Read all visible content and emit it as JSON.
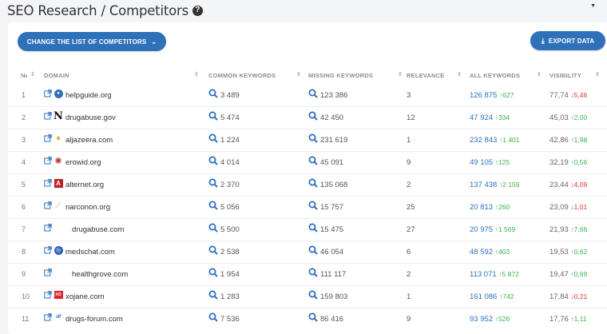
{
  "header": {
    "title": "SEO Research / Competitors",
    "help_icon": "?"
  },
  "toolbar": {
    "change_label": "CHANGE THE LIST OF COMPETITORS",
    "export_label": "EXPORT DATA"
  },
  "table": {
    "columns": [
      "№",
      "DOMAIN",
      "COMMON KEYWORDS",
      "MISSING KEYWORDS",
      "RELEVANCE",
      "ALL KEYWORDS",
      "VISIBILITY"
    ],
    "rows": [
      {
        "n": "1",
        "domain": "helpguide.org",
        "fav": "globe",
        "common": "3 489",
        "missing": "123 386",
        "relevance": "3",
        "all": "126 875",
        "all_change": "627",
        "all_dir": "up",
        "vis": "77,74",
        "vis_change": "5,46",
        "vis_dir": "down"
      },
      {
        "n": "2",
        "domain": "drugabuse.gov",
        "fav": "N",
        "common": "5 474",
        "missing": "42 450",
        "relevance": "12",
        "all": "47 924",
        "all_change": "334",
        "all_dir": "up",
        "vis": "45,03",
        "vis_change": "2,00",
        "vis_dir": "up"
      },
      {
        "n": "3",
        "domain": "aljazeera.com",
        "fav": "flame",
        "common": "1 224",
        "missing": "231 619",
        "relevance": "1",
        "all": "232 843",
        "all_change": "1 401",
        "all_dir": "up",
        "vis": "42,86",
        "vis_change": "1,98",
        "vis_dir": "up"
      },
      {
        "n": "4",
        "domain": "erowid.org",
        "fav": "gear",
        "common": "4 014",
        "missing": "45 091",
        "relevance": "9",
        "all": "49 105",
        "all_change": "125",
        "all_dir": "up",
        "vis": "32,19",
        "vis_change": "0,56",
        "vis_dir": "up"
      },
      {
        "n": "5",
        "domain": "alternet.org",
        "fav": "A",
        "common": "2 370",
        "missing": "135 068",
        "relevance": "2",
        "all": "137 438",
        "all_change": "2 159",
        "all_dir": "up",
        "vis": "23,44",
        "vis_change": "4,09",
        "vis_dir": "down"
      },
      {
        "n": "6",
        "domain": "narconon.org",
        "fav": "feather",
        "common": "5 056",
        "missing": "15 757",
        "relevance": "25",
        "all": "20 813",
        "all_change": "260",
        "all_dir": "up",
        "vis": "23,09",
        "vis_change": "1,01",
        "vis_dir": "down"
      },
      {
        "n": "7",
        "domain": "drugabuse.com",
        "fav": "",
        "common": "5 500",
        "missing": "15 475",
        "relevance": "27",
        "all": "20 975",
        "all_change": "1 569",
        "all_dir": "up",
        "vis": "21,93",
        "vis_change": "7,66",
        "vis_dir": "up"
      },
      {
        "n": "8",
        "domain": "medschat.com",
        "fav": "circle",
        "common": "2 538",
        "missing": "46 054",
        "relevance": "6",
        "all": "48 592",
        "all_change": "403",
        "all_dir": "up",
        "vis": "19,53",
        "vis_change": "0,62",
        "vis_dir": "up"
      },
      {
        "n": "9",
        "domain": "healthgrove.com",
        "fav": "",
        "common": "1 954",
        "missing": "111 117",
        "relevance": "2",
        "all": "113 071",
        "all_change": "5 872",
        "all_dir": "up",
        "vis": "19,47",
        "vis_change": "0,69",
        "vis_dir": "up"
      },
      {
        "n": "10",
        "domain": "xojane.com",
        "fav": "XO",
        "common": "1 283",
        "missing": "159 803",
        "relevance": "1",
        "all": "161 086",
        "all_change": "742",
        "all_dir": "up",
        "vis": "17,84",
        "vis_change": "0,21",
        "vis_dir": "down"
      },
      {
        "n": "11",
        "domain": "drugs-forum.com",
        "fav": "df",
        "common": "7 536",
        "missing": "86 416",
        "relevance": "9",
        "all": "93 952",
        "all_change": "526",
        "all_dir": "up",
        "vis": "17,76",
        "vis_change": "1,11",
        "vis_dir": "up"
      }
    ]
  },
  "colors": {
    "accent": "#2e71b9",
    "up": "#3db14a",
    "down": "#e1322a"
  }
}
